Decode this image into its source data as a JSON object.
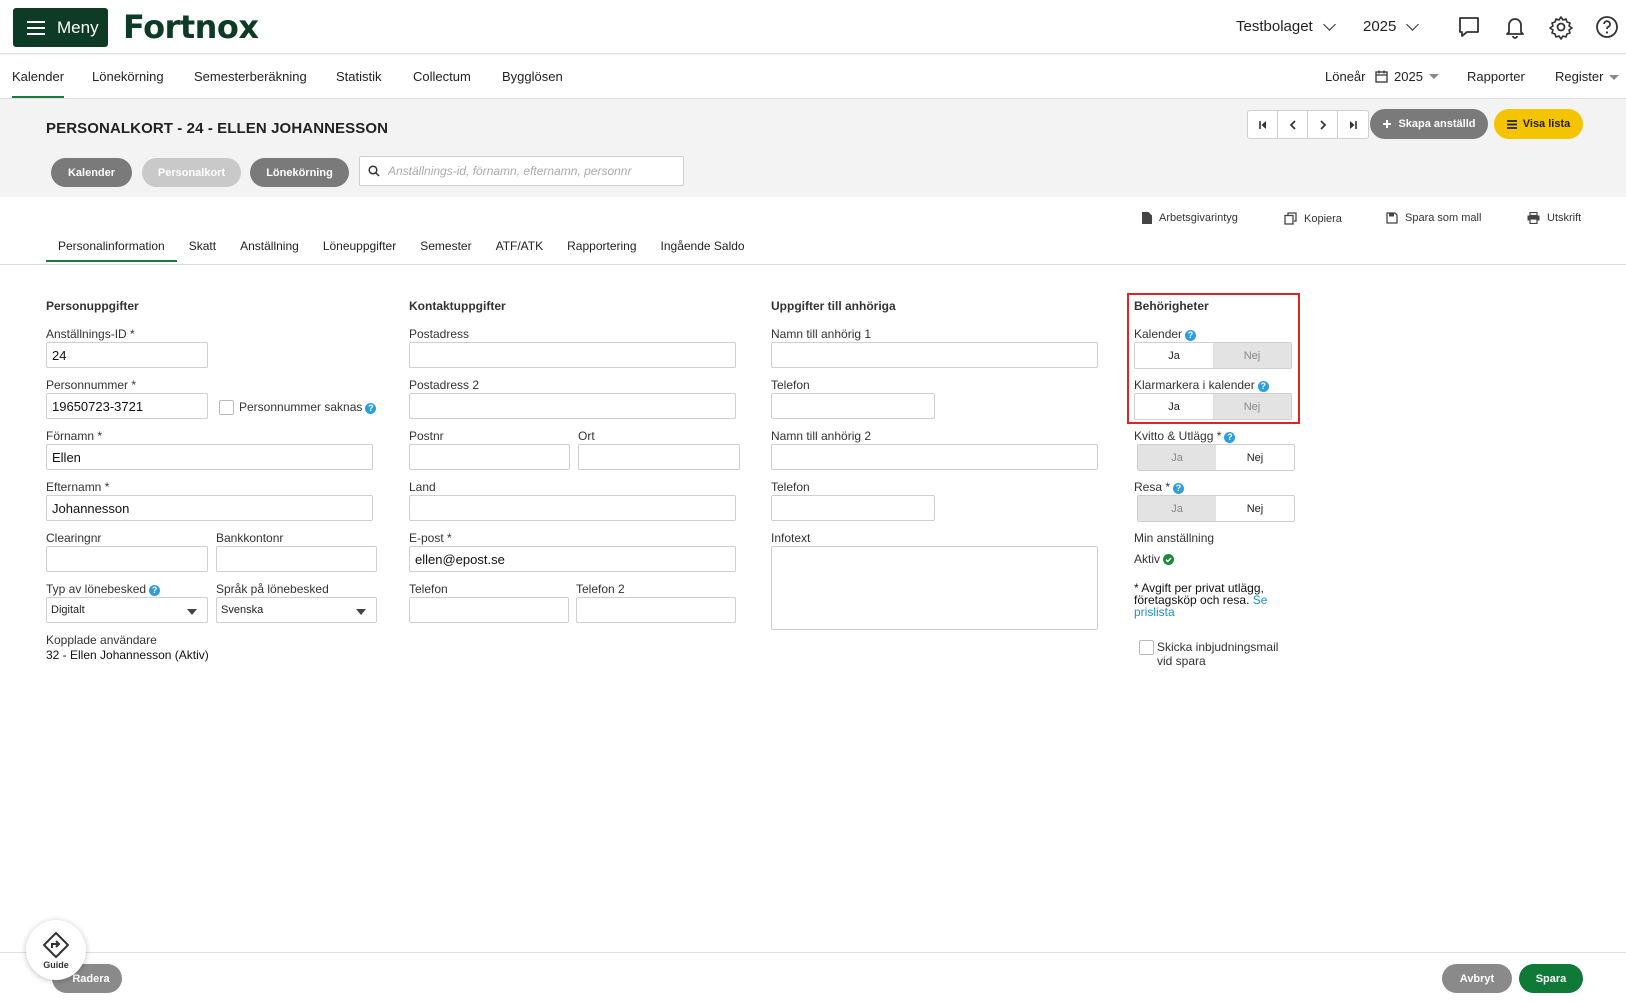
{
  "topbar": {
    "menu_label": "Meny",
    "logo": "Fortnox",
    "company": "Testbolaget",
    "year": "2025"
  },
  "nav": {
    "items": [
      "Kalender",
      "Lönekörning",
      "Semesterberäkning",
      "Statistik",
      "Collectum",
      "Bygglösen"
    ],
    "loneaar_label": "Löneår",
    "loneaar_value": "2025",
    "rapporter": "Rapporter",
    "register": "Register"
  },
  "header": {
    "title": "PERSONALKORT - 24 - ELLEN JOHANNESSON",
    "pills": [
      "Kalender",
      "Personalkort",
      "Lönekörning"
    ],
    "search_placeholder": "Anställnings-id, förnamn, efternamn, personnr",
    "create_label": "Skapa anställd",
    "list_label": "Visa lista"
  },
  "actions": [
    "Arbetsgivarintyg",
    "Kopiera",
    "Spara som mall",
    "Utskrift"
  ],
  "tabs": [
    "Personalinformation",
    "Skatt",
    "Anställning",
    "Löneuppgifter",
    "Semester",
    "ATF/ATK",
    "Rapportering",
    "Ingående Saldo"
  ],
  "person": {
    "title": "Personuppgifter",
    "id_label": "Anställnings-ID *",
    "id_value": "24",
    "pnr_label": "Personnummer *",
    "pnr_value": "19650723-3721",
    "pnr_missing": "Personnummer saknas",
    "first_label": "Förnamn *",
    "first_value": "Ellen",
    "last_label": "Efternamn *",
    "last_value": "Johannesson",
    "clearing_label": "Clearingnr",
    "bank_label": "Bankkontonr",
    "slip_type_label": "Typ av lönebesked",
    "slip_type_value": "Digitalt",
    "slip_lang_label": "Språk på lönebesked",
    "slip_lang_value": "Svenska",
    "linked_label": "Kopplade användare",
    "linked_value": "32 - Ellen Johannesson (Aktiv)"
  },
  "contact": {
    "title": "Kontaktuppgifter",
    "addr_label": "Postadress",
    "addr2_label": "Postadress 2",
    "zip_label": "Postnr",
    "city_label": "Ort",
    "country_label": "Land",
    "email_label": "E-post *",
    "email_value": "ellen@epost.se",
    "phone_label": "Telefon",
    "phone2_label": "Telefon 2"
  },
  "relatives": {
    "title": "Uppgifter till anhöriga",
    "name1_label": "Namn till anhörig 1",
    "phone1_label": "Telefon",
    "name2_label": "Namn till anhörig 2",
    "phone2_label": "Telefon",
    "info_label": "Infotext"
  },
  "permissions": {
    "title": "Behörigheter",
    "kalender_label": "Kalender",
    "klarmarkera_label": "Klarmarkera i kalender",
    "kvitto_label": "Kvitto & Utlägg *",
    "resa_label": "Resa *",
    "yes": "Ja",
    "no": "Nej",
    "employment_label": "Min anställning",
    "employment_value": "Aktiv",
    "note": "* Avgift per privat utlägg, företagsköp och resa.",
    "note_link": "Se prislista",
    "invite_label": "Skicka inbjudningsmail vid spara"
  },
  "footer": {
    "delete": "Radera",
    "cancel": "Avbryt",
    "save": "Spara",
    "guide": "Guide"
  },
  "colors": {
    "brand": "#0e3b26",
    "save": "#0f7a37",
    "highlight": "#e02424",
    "accent_yellow": "#f5c400"
  }
}
